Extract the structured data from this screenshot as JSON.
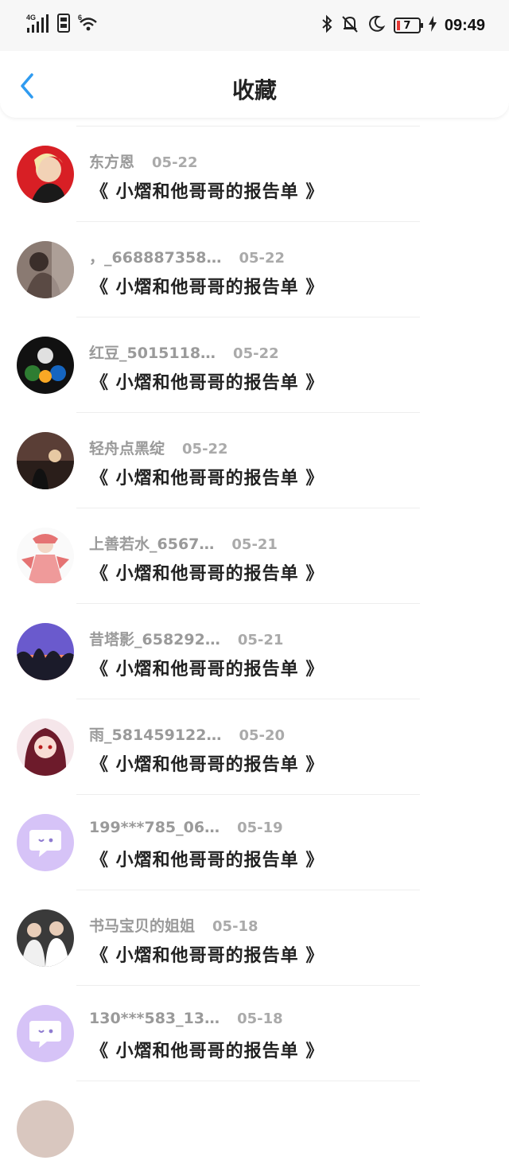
{
  "status_bar": {
    "network": "4G",
    "wifi_label": "6",
    "battery": "7",
    "time": "09:49"
  },
  "header": {
    "title": "收藏"
  },
  "items": [
    {
      "name": "东方恩",
      "date": "05-22",
      "title": "《 小熠和他哥哥的报告单 》",
      "avatar": "photo-red"
    },
    {
      "name": "，_668887358…",
      "date": "05-22",
      "title": "《 小熠和他哥哥的报告单 》",
      "avatar": "photo-brown"
    },
    {
      "name": "红豆_5015118…",
      "date": "05-22",
      "title": "《 小熠和他哥哥的报告单 》",
      "avatar": "photo-dark"
    },
    {
      "name": "轻舟点黑绽",
      "date": "05-22",
      "title": "《 小熠和他哥哥的报告单 》",
      "avatar": "photo-sunset"
    },
    {
      "name": "上善若水_6567…",
      "date": "05-21",
      "title": "《 小熠和他哥哥的报告单 》",
      "avatar": "photo-anime-red"
    },
    {
      "name": "昔塔影_658292…",
      "date": "05-21",
      "title": "《 小熠和他哥哥的报告单 》",
      "avatar": "photo-purple"
    },
    {
      "name": "雨_581459122…",
      "date": "05-20",
      "title": "《 小熠和他哥哥的报告单 》",
      "avatar": "photo-anime-girl"
    },
    {
      "name": "199***785_06…",
      "date": "05-19",
      "title": "《 小熠和他哥哥的报告单 》",
      "avatar": "chat-icon"
    },
    {
      "name": "书马宝贝的姐姐",
      "date": "05-18",
      "title": "《 小熠和他哥哥的报告单 》",
      "avatar": "photo-people"
    },
    {
      "name": "130***583_13…",
      "date": "05-18",
      "title": "《 小熠和他哥哥的报告单 》",
      "avatar": "chat-icon"
    }
  ],
  "colors": {
    "accent": "#2f9bf0",
    "chat_avatar_bg": "#d6c3f7"
  }
}
